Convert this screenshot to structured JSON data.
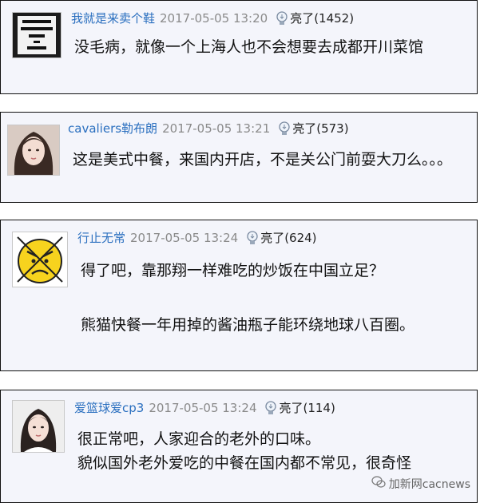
{
  "comments": [
    {
      "username": "我就是来卖个鞋",
      "time": "2017-05-05 13:20",
      "likes": "亮了(1452)",
      "lines": [
        "没毛病，就像一个上海人也不会想要去成都开川菜馆"
      ],
      "avatar_lettering": "DON'T GROW UP IT'S A TRAP"
    },
    {
      "username": "cavaliers勒布朗",
      "time": "2017-05-05 13:21",
      "likes": "亮了(573)",
      "lines": [
        "这是美式中餐，来国内开店，不是关公门前耍大刀么。。。"
      ]
    },
    {
      "username": "行止无常",
      "time": "2017-05-05 13:24",
      "likes": "亮了(624)",
      "lines": [
        "得了吧，靠那翔一样难吃的炒饭在中国立足？",
        "熊猫快餐一年用掉的酱油瓶子能环绕地球八百圈。"
      ]
    },
    {
      "username": "爱篮球爱cp3",
      "time": "2017-05-05 13:24",
      "likes": "亮了(114)",
      "lines": [
        "很正常吧，人家迎合的老外的口味。",
        "貌似国外老外爱吃的中餐在国内都不常见，很奇怪"
      ]
    }
  ],
  "watermark": "加新网cacnews",
  "colors": {
    "card_bg": "#f4f5fb",
    "username": "#2a6fbf",
    "time": "#8a8a8a",
    "border": "#111111"
  }
}
